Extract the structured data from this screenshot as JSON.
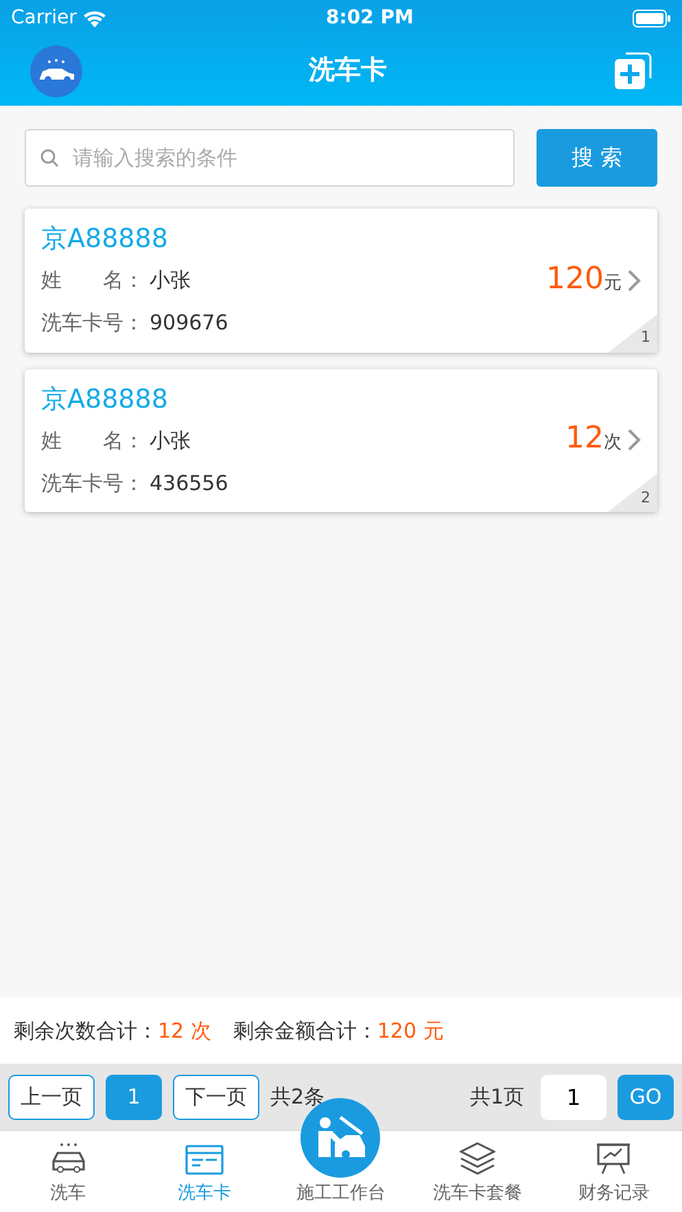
{
  "status_bar": {
    "carrier": "Carrier",
    "time": "8:02 PM"
  },
  "nav_bar": {
    "title": "洗车卡"
  },
  "search": {
    "placeholder": "请输入搜索的条件",
    "button": "搜 索"
  },
  "cards": [
    {
      "plate": "京A88888",
      "name_label": "姓　　名：",
      "name": "小张",
      "card_label": "洗车卡号：",
      "card_no": "909676",
      "amount": "120",
      "unit": "元",
      "index": "1"
    },
    {
      "plate": "京A88888",
      "name_label": "姓　　名：",
      "name": "小张",
      "card_label": "洗车卡号：",
      "card_no": "436556",
      "amount": "12",
      "unit": "次",
      "index": "2"
    }
  ],
  "summary": [
    {
      "label": "剩余次数合计：",
      "value": "12 次"
    },
    {
      "label": "剩余金额合计：",
      "value": "120 元"
    }
  ],
  "pager": {
    "prev": "上一页",
    "current": "1",
    "next": "下一页",
    "total_items": "共2条",
    "total_pages": "共1页",
    "page_input": "1",
    "go": "GO"
  },
  "tab_bar": [
    {
      "kind": "car",
      "label": "洗车",
      "selected": false
    },
    {
      "kind": "card",
      "label": "洗车卡",
      "selected": true
    },
    {
      "kind": "center",
      "label": "施工工作台",
      "selected": false
    },
    {
      "kind": "layers",
      "label": "洗车卡套餐",
      "selected": false
    },
    {
      "kind": "chart",
      "label": "财务记录",
      "selected": false
    }
  ]
}
